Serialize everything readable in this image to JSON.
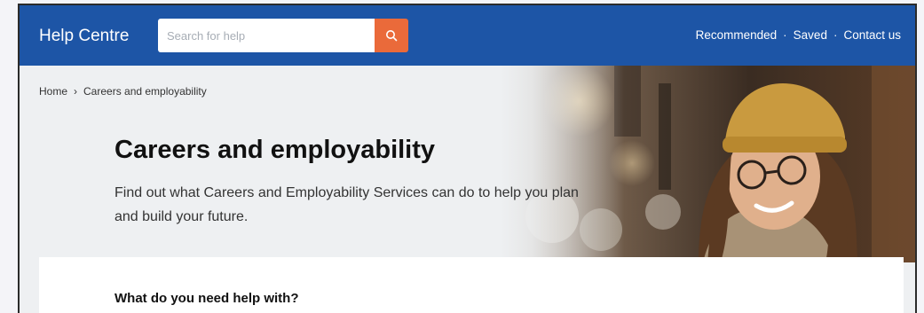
{
  "header": {
    "brand": "Help Centre",
    "search": {
      "placeholder": "Search for help",
      "value": ""
    },
    "nav": {
      "recommended": "Recommended",
      "saved": "Saved",
      "contact": "Contact us",
      "separator": "·"
    }
  },
  "breadcrumb": {
    "home": "Home",
    "separator": "›",
    "current": "Careers and employability"
  },
  "hero": {
    "title": "Careers and employability",
    "description": "Find out what Careers and Employability Services can do to help you plan and build your future."
  },
  "help_panel": {
    "heading": "What do you need help with?"
  },
  "colors": {
    "header": "#1d55a6",
    "search_button": "#ea6a3a",
    "page_bg": "#eef0f2"
  }
}
